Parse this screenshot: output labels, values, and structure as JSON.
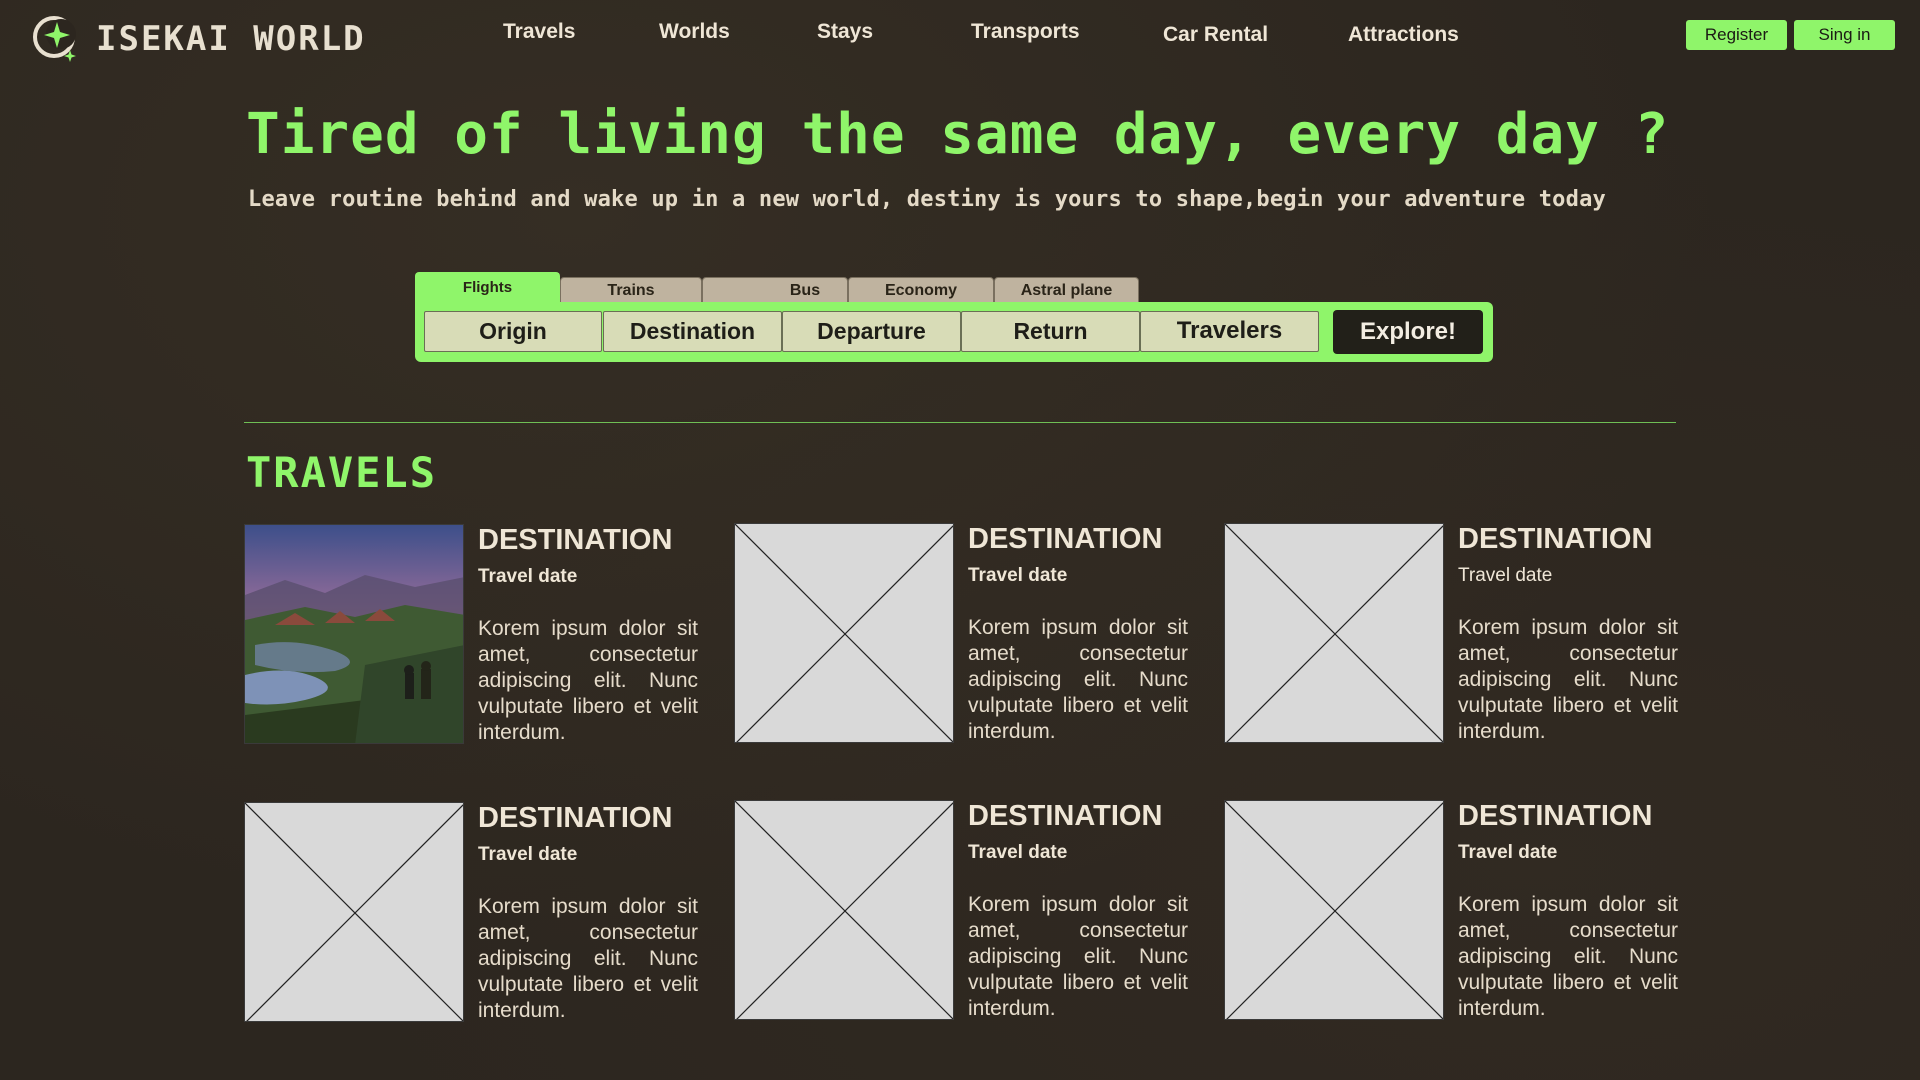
{
  "brand": {
    "name": "ISEKAI WORLD"
  },
  "nav": {
    "items": [
      "Travels",
      "Worlds",
      "Stays",
      "Transports",
      "Car Rental",
      "Attractions"
    ]
  },
  "auth": {
    "register": "Register",
    "signin": "Sing in"
  },
  "hero": {
    "title": "Tired of living the same day, every day ?",
    "subtitle": "Leave routine behind and wake up in a new world, destiny is yours to shape,begin your adventure today"
  },
  "search": {
    "tabs": [
      "Flights",
      "Trains",
      "Bus",
      "Economy",
      "Astral plane"
    ],
    "active_tab": "Flights",
    "fields": [
      "Origin",
      "Destination",
      "Departure",
      "Return",
      "Travelers"
    ],
    "submit": "Explore!"
  },
  "travels": {
    "heading": "TRAVELS",
    "cards": [
      {
        "title": "DESTINATION",
        "date": "Travel date",
        "desc": "Korem ipsum dolor sit amet, consectetur adipiscing elit. Nunc vulputate libero et velit interdum.",
        "image": "landscape-painting"
      },
      {
        "title": "DESTINATION",
        "date": "Travel date",
        "desc": "Korem ipsum dolor sit amet, consectetur adipiscing elit. Nunc vulputate libero et velit interdum.",
        "image": "placeholder"
      },
      {
        "title": "DESTINATION",
        "date": "Travel date",
        "desc": "Korem ipsum dolor sit amet, consectetur adipiscing elit. Nunc vulputate libero et velit interdum.",
        "image": "placeholder"
      },
      {
        "title": "DESTINATION",
        "date": "Travel date",
        "desc": "Korem ipsum dolor sit amet, consectetur adipiscing elit. Nunc vulputate libero et velit interdum.",
        "image": "placeholder"
      },
      {
        "title": "DESTINATION",
        "date": "Travel date",
        "desc": "Korem ipsum dolor sit amet, consectetur adipiscing elit. Nunc vulputate libero et velit interdum.",
        "image": "placeholder"
      },
      {
        "title": "DESTINATION",
        "date": "Travel date",
        "desc": "Korem ipsum dolor sit amet, consectetur adipiscing elit. Nunc vulputate libero et velit interdum.",
        "image": "placeholder"
      }
    ]
  },
  "colors": {
    "accent": "#8ff56a",
    "background": "#2c261f",
    "tab_inactive": "#bfb39f",
    "field": "#d8dcb7"
  }
}
